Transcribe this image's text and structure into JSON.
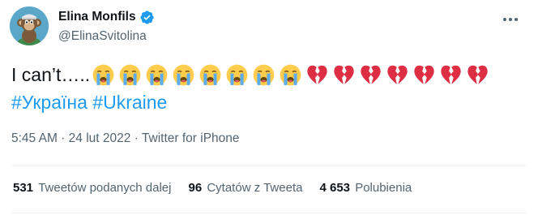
{
  "author": {
    "display_name": "Elina Monfils",
    "handle": "@ElinaSvitolina",
    "verified": true,
    "avatar_icon": "monkey-avatar-icon"
  },
  "tweet": {
    "text_prefix": "I can’t…..",
    "emojis": [
      "loudly-crying-face",
      "loudly-crying-face",
      "loudly-crying-face",
      "loudly-crying-face",
      "loudly-crying-face",
      "loudly-crying-face",
      "loudly-crying-face",
      "loudly-crying-face",
      "broken-heart",
      "broken-heart",
      "broken-heart",
      "broken-heart",
      "broken-heart",
      "broken-heart",
      "broken-heart"
    ],
    "hashtags": [
      "#Україна",
      "#Ukraine"
    ]
  },
  "meta": {
    "time": "5:45 AM",
    "separator": "·",
    "date": "24 lut 2022",
    "source": "Twitter for iPhone"
  },
  "stats": {
    "retweets": {
      "count": "531",
      "label": "Tweetów podanych dalej"
    },
    "quotes": {
      "count": "96",
      "label": "Cytatów z Tweeta"
    },
    "likes": {
      "count": "4 653",
      "label": "Polubienia"
    }
  },
  "colors": {
    "link": "#1d9bf0",
    "secondary_text": "#536471",
    "primary_text": "#0f1419",
    "verified": "#1d9bf0"
  }
}
